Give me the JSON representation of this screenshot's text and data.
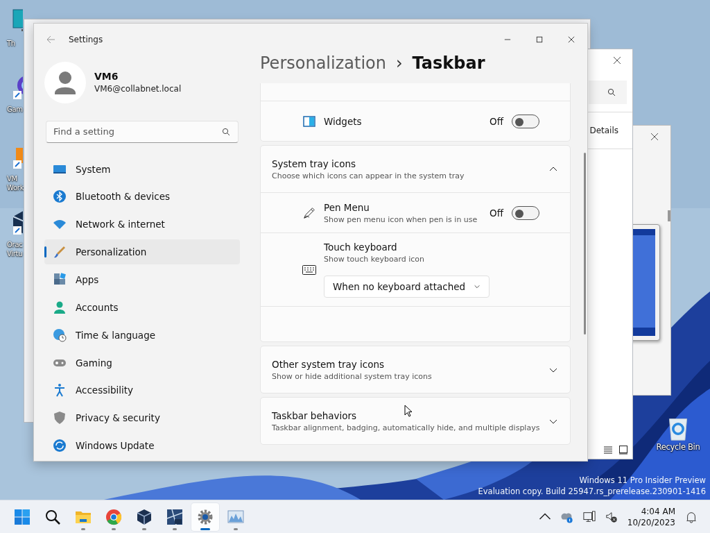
{
  "desktop": {
    "icons": [
      {
        "lines": [
          "Th"
        ]
      },
      {
        "lines": [
          "Gam"
        ]
      },
      {
        "lines": [
          "VM",
          "Work"
        ]
      },
      {
        "lines": [
          "Orac",
          "Virtu"
        ]
      }
    ],
    "recycle_bin": "Recycle Bin",
    "watermark": [
      "Windows 11 Pro Insider Preview",
      "Evaluation copy. Build 25947.rs_prerelease.230901-1416"
    ]
  },
  "background_window": {
    "tab": "Details"
  },
  "settings": {
    "title": "Settings",
    "user": {
      "name": "VM6",
      "email": "VM6@collabnet.local"
    },
    "search": {
      "placeholder": "Find a setting"
    },
    "nav": [
      {
        "label": "System",
        "selected": false
      },
      {
        "label": "Bluetooth & devices",
        "selected": false
      },
      {
        "label": "Network & internet",
        "selected": false
      },
      {
        "label": "Personalization",
        "selected": true
      },
      {
        "label": "Apps",
        "selected": false
      },
      {
        "label": "Accounts",
        "selected": false
      },
      {
        "label": "Time & language",
        "selected": false
      },
      {
        "label": "Gaming",
        "selected": false
      },
      {
        "label": "Accessibility",
        "selected": false
      },
      {
        "label": "Privacy & security",
        "selected": false
      },
      {
        "label": "Windows Update",
        "selected": false
      }
    ],
    "breadcrumb": {
      "parent": "Personalization",
      "separator": "›",
      "current": "Taskbar"
    },
    "cards": [
      {
        "items": [
          {
            "kind": "toggle",
            "label": "Widgets",
            "state": "Off",
            "on": false
          }
        ]
      },
      {
        "title": "System tray icons",
        "subtitle": "Choose which icons can appear in the system tray",
        "expanded": true,
        "items": [
          {
            "kind": "toggle",
            "label": "Pen Menu",
            "subtitle": "Show pen menu icon when pen is in use",
            "state": "Off",
            "on": false
          },
          {
            "kind": "dropdown",
            "label": "Touch keyboard",
            "subtitle": "Show touch keyboard icon",
            "value": "When no keyboard attached"
          }
        ]
      },
      {
        "title": "Other system tray icons",
        "subtitle": "Show or hide additional system tray icons",
        "expanded": false
      },
      {
        "title": "Taskbar behaviors",
        "subtitle": "Taskbar alignment, badging, automatically hide, and multiple displays",
        "expanded": false
      }
    ]
  },
  "taskbar": {
    "apps": [
      {
        "running": false,
        "selected": false
      },
      {
        "running": false,
        "selected": false
      },
      {
        "running": true,
        "selected": false
      },
      {
        "running": true,
        "selected": false
      },
      {
        "running": true,
        "selected": false
      },
      {
        "running": true,
        "selected": false
      },
      {
        "running": true,
        "selected": true
      },
      {
        "running": true,
        "selected": false
      }
    ],
    "clock": {
      "time": "4:04 AM",
      "date": "10/20/2023"
    }
  }
}
